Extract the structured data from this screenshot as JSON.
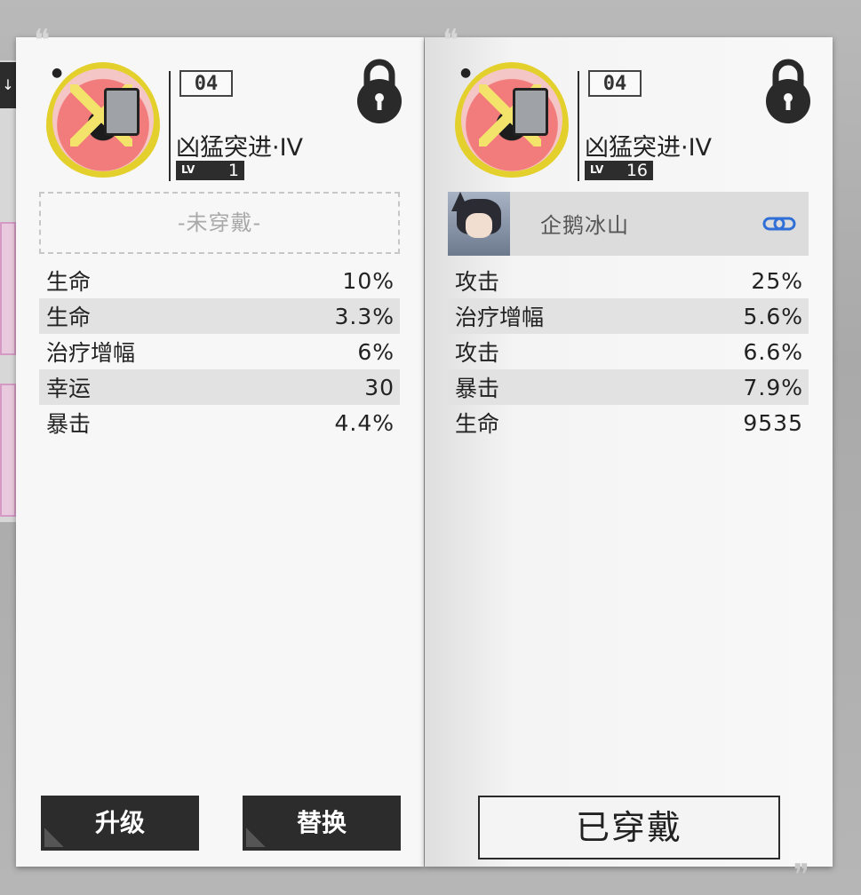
{
  "left_card": {
    "number": "04",
    "name": "凶猛突进·IV",
    "level_tag": "LV",
    "level": "1",
    "unequipped_label": "-未穿戴-",
    "stats": [
      {
        "label": "生命",
        "value": "10%"
      },
      {
        "label": "生命",
        "value": "3.3%"
      },
      {
        "label": "治疗增幅",
        "value": "6%"
      },
      {
        "label": "幸运",
        "value": "30"
      },
      {
        "label": "暴击",
        "value": "4.4%"
      }
    ],
    "upgrade_button": "升级",
    "replace_button": "替换"
  },
  "right_card": {
    "number": "04",
    "name": "凶猛突进·IV",
    "level_tag": "LV",
    "level": "16",
    "equipped_character": "企鹅冰山",
    "stats": [
      {
        "label": "攻击",
        "value": "25%"
      },
      {
        "label": "治疗增幅",
        "value": "5.6%"
      },
      {
        "label": "攻击",
        "value": "6.6%"
      },
      {
        "label": "暴击",
        "value": "7.9%"
      },
      {
        "label": "生命",
        "value": "9535"
      }
    ],
    "equipped_button": "已穿戴"
  },
  "icons": [
    "lock-icon",
    "link-icon",
    "paw-icon",
    "arrow-down-icon"
  ],
  "colors": {
    "card_bg": "#f7f7f7",
    "button_dark": "#2c2c2c",
    "portrait_ring": "#e4d02c",
    "link_blue": "#2f6fd6"
  }
}
